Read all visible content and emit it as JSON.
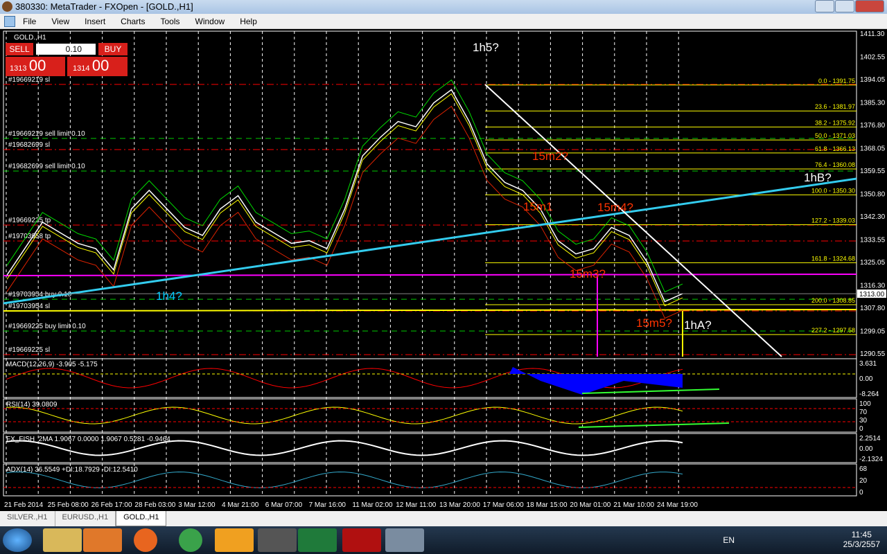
{
  "window": {
    "title": "380330: MetaTrader - FXOpen - [GOLD.,H1]"
  },
  "menu": [
    "File",
    "View",
    "Insert",
    "Charts",
    "Tools",
    "Window",
    "Help"
  ],
  "chart": {
    "symbol": "GOLD.,H1",
    "trade": {
      "sell_label": "SELL",
      "buy_label": "BUY",
      "lot": "0.10",
      "bid_big": "1313",
      "bid_small": "00",
      "ask_big": "1314",
      "ask_small": "00"
    },
    "current_price": "1313.00",
    "price_ticks": [
      "1411.30",
      "1402.55",
      "1394.05",
      "1385.30",
      "1376.80",
      "1368.05",
      "1359.55",
      "1350.80",
      "1342.30",
      "1333.55",
      "1325.05",
      "1316.30",
      "1307.80",
      "1299.05",
      "1290.55"
    ],
    "price_range": [
      1290.55,
      1411.3
    ],
    "fib_levels": [
      {
        "label": "0.0 - 1391.75",
        "price": 1391.75
      },
      {
        "label": "23.6 - 1381.97",
        "price": 1381.97
      },
      {
        "label": "38.2 - 1375.92",
        "price": 1375.92
      },
      {
        "label": "50.0 - 1371.03",
        "price": 1371.03
      },
      {
        "label": "61.8 - 1366.13",
        "price": 1366.13
      },
      {
        "label": "76.4 - 1360.08",
        "price": 1360.08
      },
      {
        "label": "100.0 - 1350.30",
        "price": 1350.3
      },
      {
        "label": "127.2 - 1339.03",
        "price": 1339.03
      },
      {
        "label": "161.8 - 1324.68",
        "price": 1324.68
      },
      {
        "label": "200.0 - 1308.85",
        "price": 1308.85
      },
      {
        "label": "227.2 - 1297.58",
        "price": 1297.58
      }
    ],
    "orders": [
      {
        "label": "#19669219 sl",
        "price": 1392.0,
        "kind": "sl"
      },
      {
        "label": "#19669219 sell limit 0.10",
        "price": 1371.6,
        "kind": "limit"
      },
      {
        "label": "#19682699 sl",
        "price": 1367.4,
        "kind": "sl"
      },
      {
        "label": "#19682699 sell limit 0.10",
        "price": 1359.3,
        "kind": "limit"
      },
      {
        "label": "#19669225 tp",
        "price": 1338.9,
        "kind": "sl"
      },
      {
        "label": "#19703958 tp",
        "price": 1332.9,
        "kind": "sl"
      },
      {
        "label": "#19703954 buy 0.10",
        "price": 1310.9,
        "kind": "limit"
      },
      {
        "label": "#19703954 sl",
        "price": 1306.5,
        "kind": "sl"
      },
      {
        "label": "#19669225 buy limit 0.10",
        "price": 1298.9,
        "kind": "limit"
      },
      {
        "label": "#19669225 sl",
        "price": 1290.0,
        "kind": "sl"
      }
    ],
    "annotations": [
      {
        "text": "1h5?",
        "color": "#ffffff"
      },
      {
        "text": "15m2?",
        "color": "#ff3300"
      },
      {
        "text": "15m1",
        "color": "#ff3300"
      },
      {
        "text": "15m4?",
        "color": "#ff3300"
      },
      {
        "text": "15m3?",
        "color": "#ff3300"
      },
      {
        "text": "15m5?",
        "color": "#ff3300"
      },
      {
        "text": "1hA?",
        "color": "#ffffff"
      },
      {
        "text": "1hB?",
        "color": "#ffffff"
      },
      {
        "text": "1h4?",
        "color": "#00ccff"
      }
    ],
    "close_path": [
      1320,
      1330,
      1340,
      1336,
      1332,
      1330,
      1322,
      1345,
      1352,
      1345,
      1338,
      1335,
      1345,
      1350,
      1340,
      1336,
      1332,
      1333,
      1330,
      1345,
      1365,
      1372,
      1378,
      1376,
      1385,
      1390,
      1378,
      1362,
      1355,
      1352,
      1345,
      1333,
      1328,
      1330,
      1338,
      1335,
      1325,
      1310,
      1313
    ]
  },
  "indicators": {
    "macd": {
      "label": "MACD(12,26,9) -3.905 -5.175",
      "ticks": [
        "3.631",
        "0.00",
        "-8.264"
      ]
    },
    "rsi": {
      "label": "RSI(14) 39.0809",
      "ticks": [
        "100",
        "70",
        "30",
        "0"
      ]
    },
    "fish": {
      "label": "FX_FISH_2MA 1.9067 0.0000 1.9067 0.5281 -0.9464",
      "ticks": [
        "2.2514",
        "0.00",
        "-2.1324"
      ]
    },
    "adx": {
      "label": "ADX(14) 36.5549 +DI:18.7929 -DI:12.5410",
      "ticks": [
        "68",
        "20",
        "0"
      ]
    }
  },
  "time_axis": [
    "21 Feb 2014",
    "25 Feb 08:00",
    "26 Feb 17:00",
    "28 Feb 03:00",
    "3 Mar 12:00",
    "4 Mar 21:00",
    "6 Mar 07:00",
    "7 Mar 16:00",
    "11 Mar 02:00",
    "12 Mar 11:00",
    "13 Mar 20:00",
    "17 Mar 06:00",
    "18 Mar 15:00",
    "20 Mar 01:00",
    "21 Mar 10:00",
    "24 Mar 19:00"
  ],
  "tabs": [
    {
      "label": "SILVER.,H1"
    },
    {
      "label": "EURUSD.,H1"
    },
    {
      "label": "GOLD.,H1",
      "active": true
    }
  ],
  "tray": {
    "lang": "EN",
    "time": "11:45",
    "date": "25/3/2557"
  },
  "colors": {
    "fib": "#ffff00",
    "sl": "#ff0000",
    "limit": "#00cc00",
    "trend_cyan": "#33ccee",
    "magenta": "#ff00ff",
    "macd_hist": "#0000ff"
  }
}
